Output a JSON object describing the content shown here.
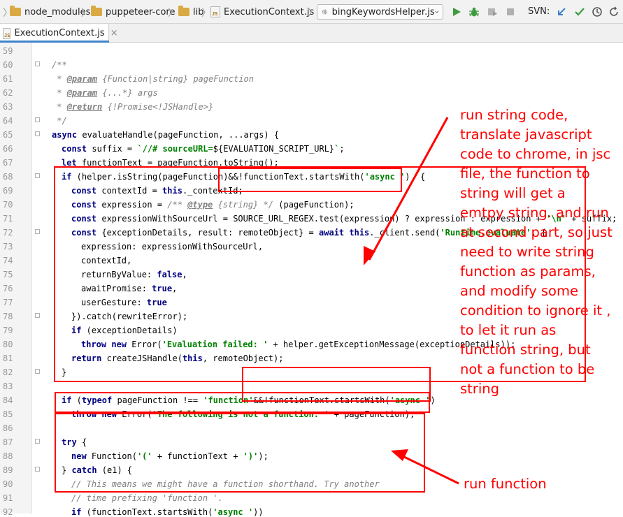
{
  "breadcrumb": {
    "items": [
      "node_modules",
      "puppeteer-core",
      "lib",
      "ExecutionContext.js"
    ]
  },
  "run_config": {
    "label": "bingKeywordsHelper.js",
    "icon": "gear-icon"
  },
  "toolbar": {
    "svn_label": "SVN:"
  },
  "tabs": [
    {
      "label": "ExecutionContext.js",
      "close": "×"
    }
  ],
  "line_numbers": [
    "59",
    "60",
    "61",
    "62",
    "63",
    "64",
    "65",
    "66",
    "67",
    "68",
    "69",
    "70",
    "71",
    "72",
    "73",
    "74",
    "75",
    "76",
    "77",
    "78",
    "79",
    "80",
    "81",
    "82",
    "83",
    "84",
    "85",
    "86",
    "87",
    "88",
    "89",
    "90",
    "91",
    "92"
  ],
  "code": {
    "l60": "/**",
    "l61a": " * ",
    "l61b": "@param",
    "l61c": " {Function|string} pageFunction",
    "l62a": " * ",
    "l62b": "@param",
    "l62c": " {...*} args",
    "l63a": " * ",
    "l63b": "@return",
    "l63c": " {!Promise<!JSHandle>}",
    "l64": " */",
    "l65a": "async",
    "l65b": " evaluateHandle(pageFunction, ...args) {",
    "l66a": "const",
    "l66b": " suffix = ",
    "l66c": "`//# sourceURL=",
    "l66d": "${EVALUATION_SCRIPT_URL}",
    "l66e": "`",
    "l66f": ";",
    "l67a": "let",
    "l67b": " functionText = pageFunction.toString();",
    "l68a": "if",
    "l68b": " (helper.isString(pageFunction)&&!functionText.startsWith(",
    "l68c": "'async '",
    "l68d": ")  {",
    "l69a": "const",
    "l69b": " contextId = ",
    "l69c": "this",
    "l69d": "._contextId;",
    "l70a": "const",
    "l70b": " expression = ",
    "l70c": "/** ",
    "l70d": "@type",
    "l70e": " {string} */",
    "l70f": " (pageFunction);",
    "l71a": "const",
    "l71b": " expressionWithSourceUrl = SOURCE_URL_REGEX.test(expression) ? expression : expression + ",
    "l71c": "'\\n'",
    "l71d": " + suffix;",
    "l72a": "const",
    "l72b": " {exceptionDetails, result: remoteObject} = ",
    "l72c": "await this",
    "l72d": "._client.send(",
    "l72e": "'Runtime.evaluate'",
    "l72f": ", {",
    "l73": "expression: expressionWithSourceUrl,",
    "l74": "contextId,",
    "l75a": "returnByValue: ",
    "l75b": "false",
    "l75c": ",",
    "l76a": "awaitPromise: ",
    "l76b": "true",
    "l76c": ",",
    "l77a": "userGesture: ",
    "l77b": "true",
    "l78": "}).catch(rewriteError);",
    "l79a": "if",
    "l79b": " (exceptionDetails)",
    "l80a": "throw new",
    "l80b": " Error(",
    "l80c": "'Evaluation failed: '",
    "l80d": " + helper.getExceptionMessage(exceptionDetails));",
    "l81a": "return",
    "l81b": " createJSHandle(",
    "l81c": "this",
    "l81d": ", remoteObject);",
    "l82": "}",
    "l84a": "if",
    "l84b": " (",
    "l84c": "typeof",
    "l84d": " pageFunction !== ",
    "l84e": "'function'",
    "l84f": "&&!functionText.startsWith(",
    "l84g": "'async '",
    "l84h": ")",
    "l85a": "throw new",
    "l85b": " Error(",
    "l85c": "'The following is not a function: '",
    "l85d": " + pageFunction);",
    "l87a": "try",
    "l87b": " {",
    "l88a": "new",
    "l88b": " Function(",
    "l88c": "'('",
    "l88d": " + functionText + ",
    "l88e": "')'",
    "l88f": ");",
    "l89a": "} ",
    "l89b": "catch",
    "l89c": " (e1) {",
    "l90": "// This means we might have a function shorthand. Try another",
    "l91": "// time prefixing 'function '.",
    "l92a": "if",
    "l92b": " (functionText.startsWith(",
    "l92c": "'async '",
    "l92d": "))"
  },
  "annotations": {
    "note1": "run string code,\ntranslate javascript\ncode to chrome, in jsc\nfile, the function to\nstring will get a\nemtpy string. and run\nat second part, so just\nneed to write string\nfunction as params,\nand modify some\ncondition to ignore it ,\nto let it run as\nfunction string, but\nnot a function to be\nstring",
    "note2": "run function",
    "color": "#ff0000"
  }
}
